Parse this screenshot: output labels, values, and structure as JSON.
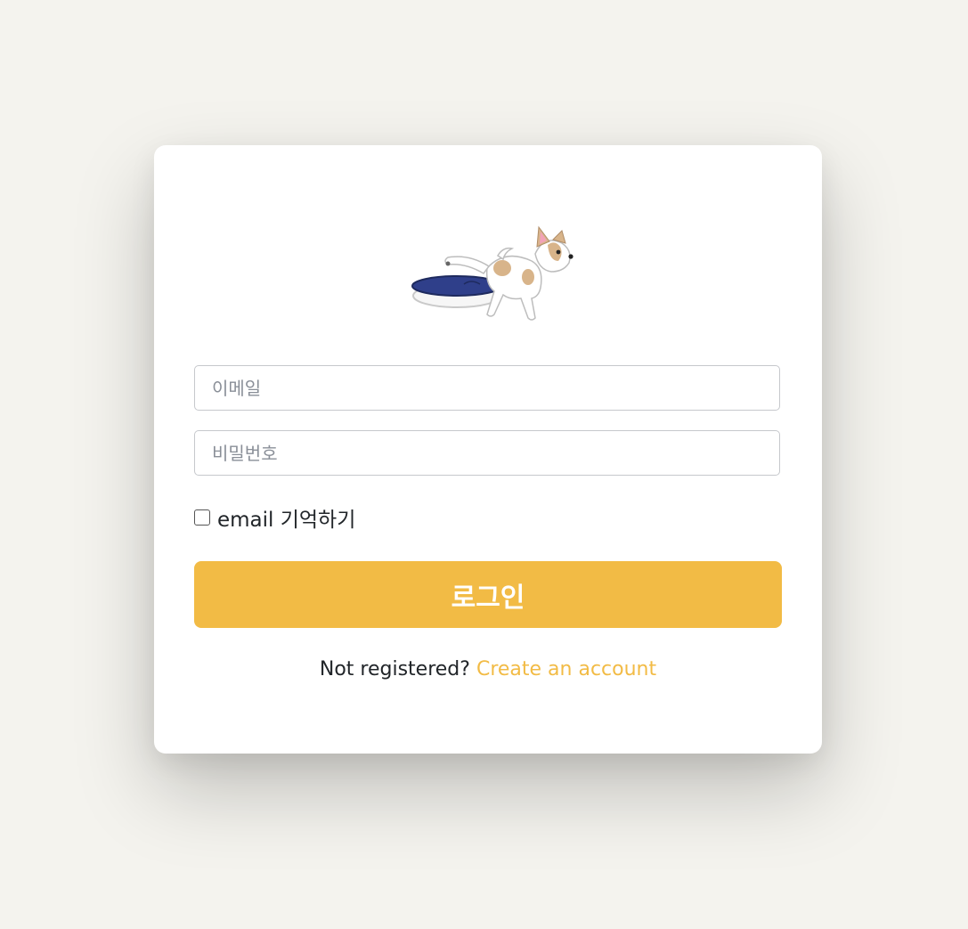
{
  "logo": {
    "icon": "dog-peeing-on-bed-illustration",
    "colors": {
      "bed": "#2f3f8a",
      "dog_patch": "#d8b48a",
      "ear": "#f2a2b8"
    }
  },
  "form": {
    "email_placeholder": "이메일",
    "password_placeholder": "비밀번호",
    "remember_label": "email 기억하기",
    "remember_checked": false,
    "login_label": "로그인"
  },
  "signup": {
    "prompt": "Not registered?",
    "link": "Create an account"
  },
  "colors": {
    "accent": "#f2bb45",
    "background": "#f4f3ee"
  }
}
